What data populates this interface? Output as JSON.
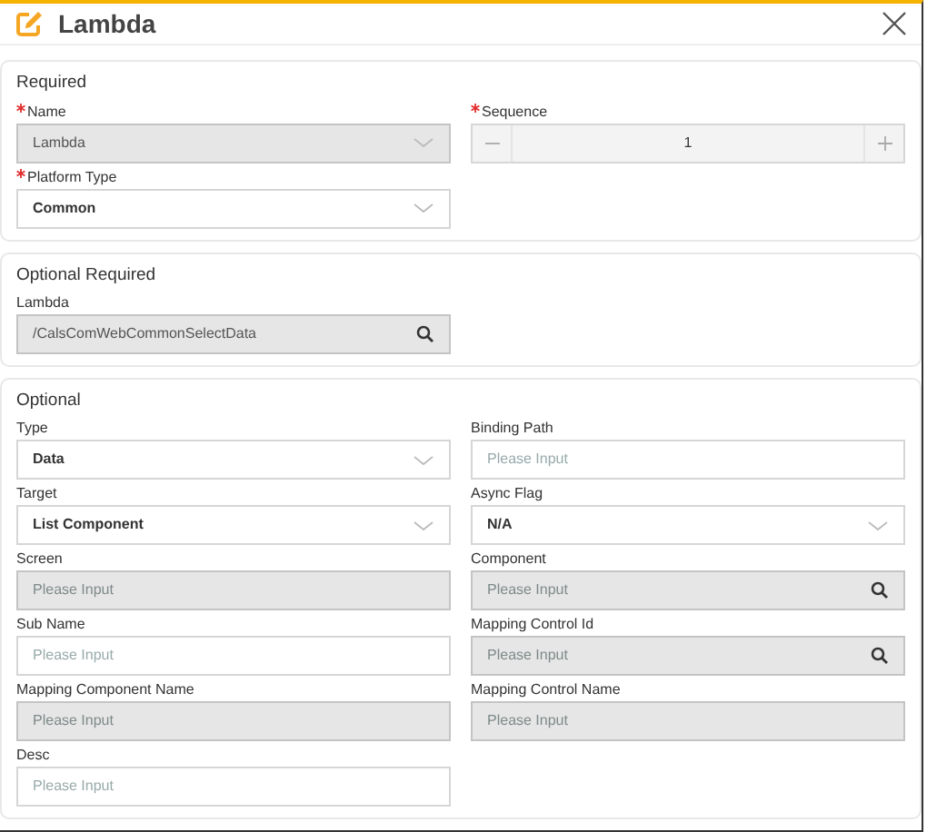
{
  "dialog": {
    "title": "Lambda"
  },
  "sections": [
    {
      "title": "Required",
      "fields": [
        {
          "label": "Name",
          "required": true,
          "kind": "select",
          "value": "Lambda",
          "disabled": true
        },
        {
          "label": "Sequence",
          "required": true,
          "kind": "number",
          "value": "1",
          "disabled": true
        },
        {
          "label": "Platform Type",
          "required": true,
          "kind": "select",
          "value": "Common",
          "disabled": false
        }
      ]
    },
    {
      "title": "Optional Required",
      "fields": [
        {
          "label": "Lambda",
          "required": false,
          "kind": "search",
          "value": "/CalsComWebCommonSelectData",
          "disabled": true
        }
      ]
    },
    {
      "title": "Optional",
      "fields": [
        {
          "label": "Type",
          "required": false,
          "kind": "select",
          "value": "Data",
          "disabled": false
        },
        {
          "label": "Binding Path",
          "required": false,
          "kind": "input",
          "placeholder": "Please Input",
          "disabled": false
        },
        {
          "label": "Target",
          "required": false,
          "kind": "select",
          "value": "List Component",
          "disabled": false
        },
        {
          "label": "Async Flag",
          "required": false,
          "kind": "select",
          "value": "N/A",
          "disabled": false
        },
        {
          "label": "Screen",
          "required": false,
          "kind": "input",
          "placeholder": "Please Input",
          "disabled": true
        },
        {
          "label": "Component",
          "required": false,
          "kind": "search",
          "placeholder": "Please Input",
          "disabled": true
        },
        {
          "label": "Sub Name",
          "required": false,
          "kind": "input",
          "placeholder": "Please Input",
          "disabled": false
        },
        {
          "label": "Mapping Control Id",
          "required": false,
          "kind": "search",
          "placeholder": "Please Input",
          "disabled": true
        },
        {
          "label": "Mapping Component Name",
          "required": false,
          "kind": "input",
          "placeholder": "Please Input",
          "disabled": true
        },
        {
          "label": "Mapping Control Name",
          "required": false,
          "kind": "input",
          "placeholder": "Please Input",
          "disabled": true
        },
        {
          "label": "Desc",
          "required": false,
          "kind": "input",
          "placeholder": "Please Input",
          "disabled": false
        }
      ]
    }
  ]
}
